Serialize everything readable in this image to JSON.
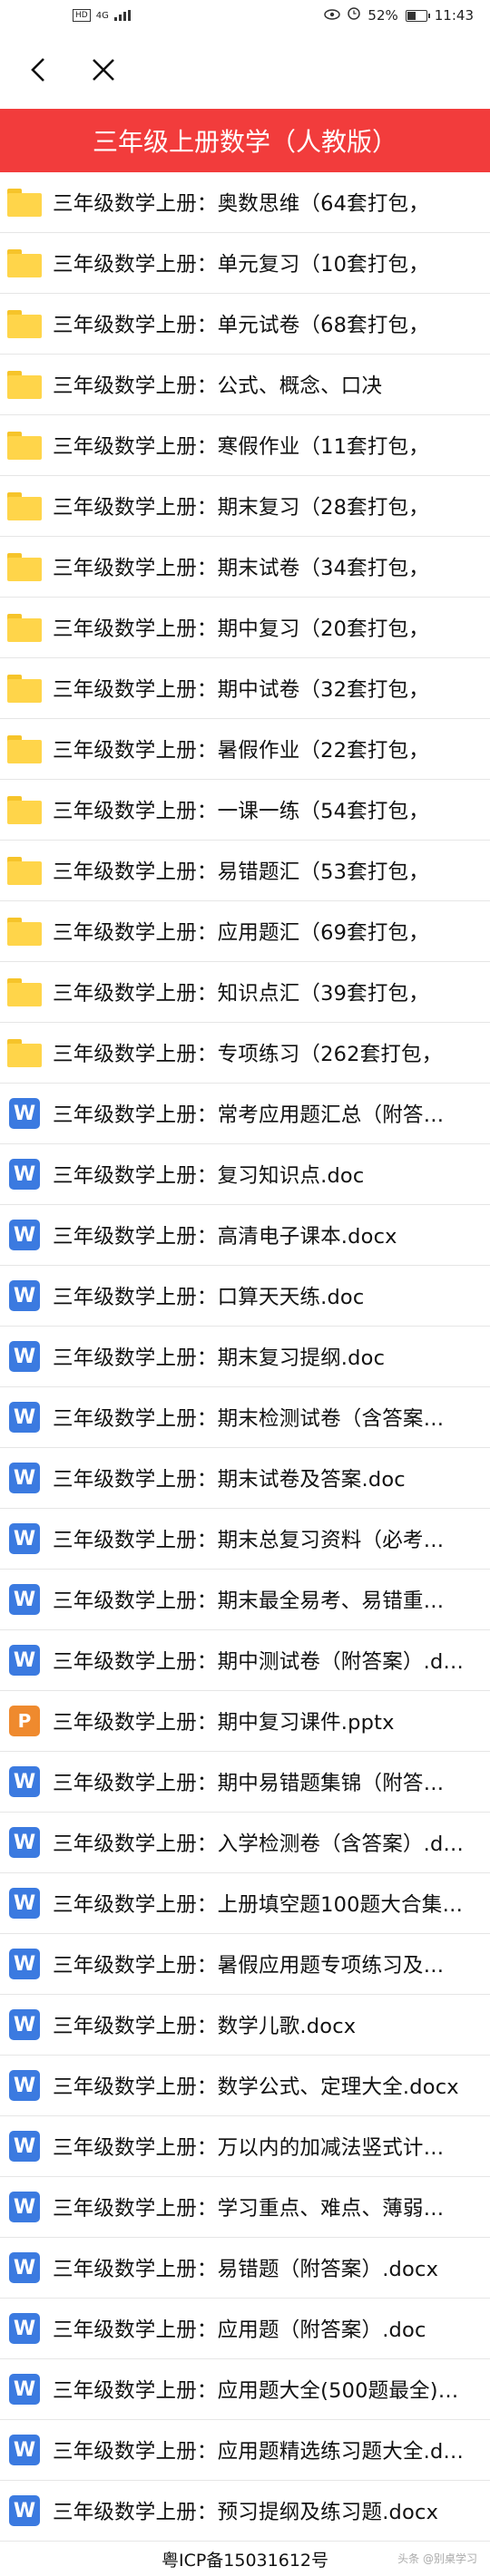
{
  "status_bar": {
    "left_badge": "HD",
    "network": "4G",
    "battery": "52%",
    "battery_level": 0.52,
    "time": "11:43"
  },
  "nav": {
    "back_icon": "chevron-left-icon",
    "close_icon": "close-icon"
  },
  "title": "三年级上册数学（人教版）",
  "items": [
    {
      "type": "folder",
      "label": "三年级数学上册：奥数思维（64套打包，"
    },
    {
      "type": "folder",
      "label": "三年级数学上册：单元复习（10套打包，"
    },
    {
      "type": "folder",
      "label": "三年级数学上册：单元试卷（68套打包，"
    },
    {
      "type": "folder",
      "label": "三年级数学上册：公式、概念、口决"
    },
    {
      "type": "folder",
      "label": "三年级数学上册：寒假作业（11套打包，"
    },
    {
      "type": "folder",
      "label": "三年级数学上册：期末复习（28套打包，"
    },
    {
      "type": "folder",
      "label": "三年级数学上册：期末试卷（34套打包，"
    },
    {
      "type": "folder",
      "label": "三年级数学上册：期中复习（20套打包，"
    },
    {
      "type": "folder",
      "label": "三年级数学上册：期中试卷（32套打包，"
    },
    {
      "type": "folder",
      "label": "三年级数学上册：暑假作业（22套打包，"
    },
    {
      "type": "folder",
      "label": "三年级数学上册：一课一练（54套打包，"
    },
    {
      "type": "folder",
      "label": "三年级数学上册：易错题汇（53套打包，"
    },
    {
      "type": "folder",
      "label": "三年级数学上册：应用题汇（69套打包，"
    },
    {
      "type": "folder",
      "label": "三年级数学上册：知识点汇（39套打包，"
    },
    {
      "type": "folder",
      "label": "三年级数学上册：专项练习（262套打包，"
    },
    {
      "type": "word",
      "label": "三年级数学上册：常考应用题汇总（附答…"
    },
    {
      "type": "word",
      "label": "三年级数学上册：复习知识点.doc"
    },
    {
      "type": "word",
      "label": "三年级数学上册：高清电子课本.docx"
    },
    {
      "type": "word",
      "label": "三年级数学上册：口算天天练.doc"
    },
    {
      "type": "word",
      "label": "三年级数学上册：期末复习提纲.doc"
    },
    {
      "type": "word",
      "label": "三年级数学上册：期末检测试卷（含答案…"
    },
    {
      "type": "word",
      "label": "三年级数学上册：期末试卷及答案.doc"
    },
    {
      "type": "word",
      "label": "三年级数学上册：期末总复习资料（必考…"
    },
    {
      "type": "word",
      "label": "三年级数学上册：期末最全易考、易错重…"
    },
    {
      "type": "word",
      "label": "三年级数学上册：期中测试卷（附答案）.d…"
    },
    {
      "type": "ppt",
      "label": "三年级数学上册：期中复习课件.pptx"
    },
    {
      "type": "word",
      "label": "三年级数学上册：期中易错题集锦（附答…"
    },
    {
      "type": "word",
      "label": "三年级数学上册：入学检测卷（含答案）.d…"
    },
    {
      "type": "word",
      "label": "三年级数学上册：上册填空题100题大合集…"
    },
    {
      "type": "word",
      "label": "三年级数学上册：暑假应用题专项练习及…"
    },
    {
      "type": "word",
      "label": "三年级数学上册：数学儿歌.docx"
    },
    {
      "type": "word",
      "label": "三年级数学上册：数学公式、定理大全.docx"
    },
    {
      "type": "word",
      "label": "三年级数学上册：万以内的加减法竖式计…"
    },
    {
      "type": "word",
      "label": "三年级数学上册：学习重点、难点、薄弱…"
    },
    {
      "type": "word",
      "label": "三年级数学上册：易错题（附答案）.docx"
    },
    {
      "type": "word",
      "label": "三年级数学上册：应用题（附答案）.doc"
    },
    {
      "type": "word",
      "label": "三年级数学上册：应用题大全(500题最全)…"
    },
    {
      "type": "word",
      "label": "三年级数学上册：应用题精选练习题大全.d…"
    },
    {
      "type": "word",
      "label": "三年级数学上册：预习提纲及练习题.docx"
    }
  ],
  "icons": {
    "W": "W",
    "P": "P"
  },
  "footer": {
    "icp": "粤ICP备15031612号",
    "watermark": "头条 @别桌学习"
  }
}
